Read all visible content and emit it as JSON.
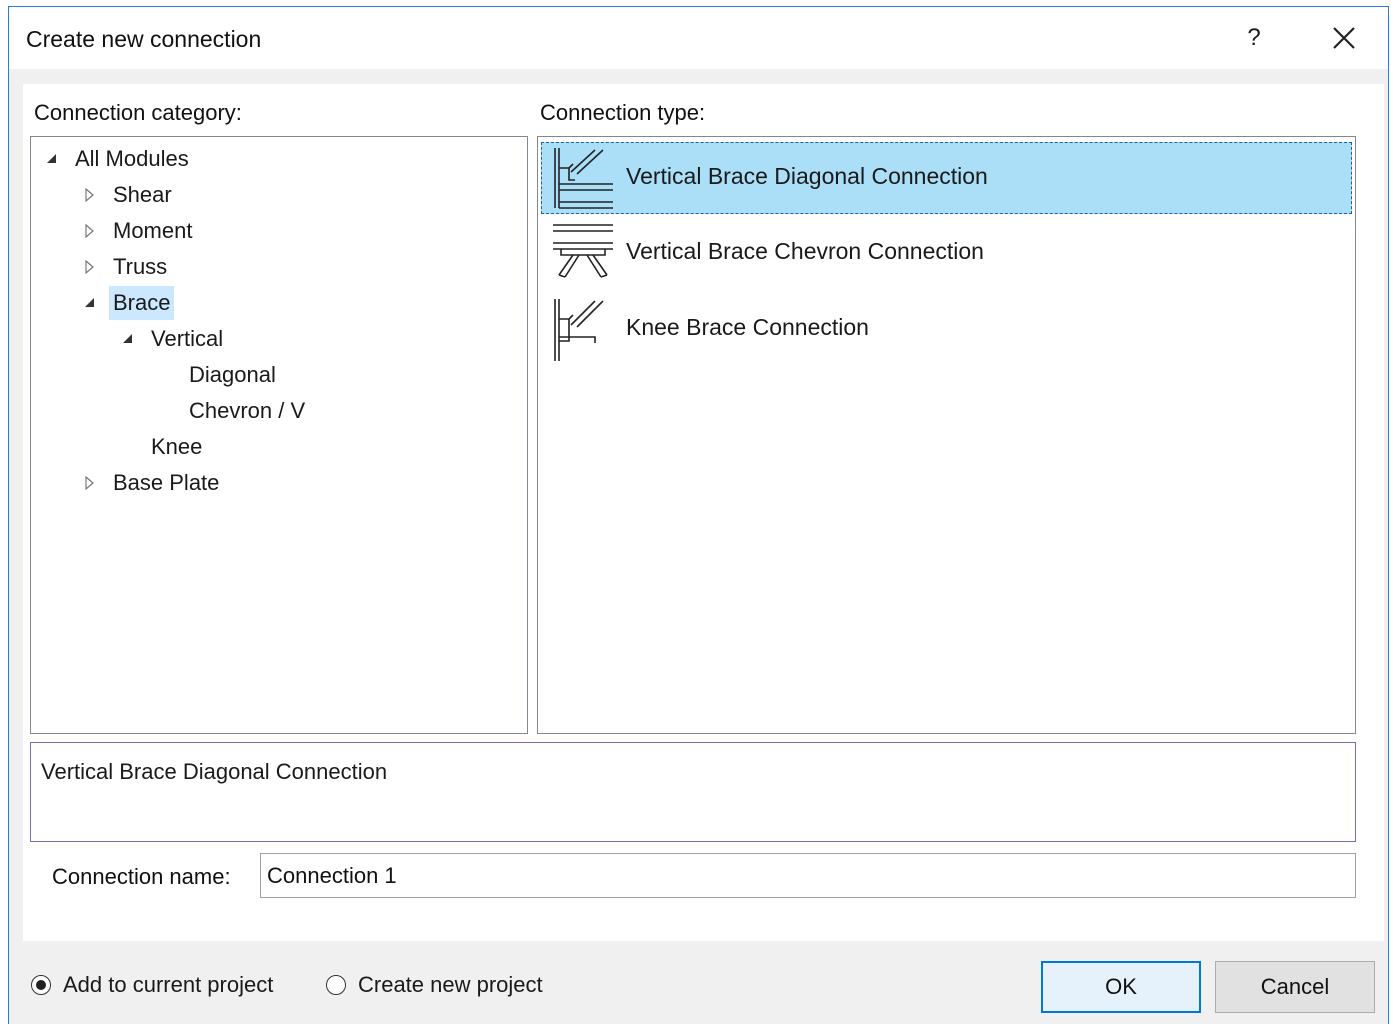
{
  "dialog": {
    "title": "Create new connection",
    "help_label": "?"
  },
  "category": {
    "label": "Connection category:",
    "tree": [
      {
        "label": "All Modules",
        "expander": "expanded"
      },
      {
        "label": "Shear",
        "expander": "collapsed"
      },
      {
        "label": "Moment",
        "expander": "collapsed"
      },
      {
        "label": "Truss",
        "expander": "collapsed"
      },
      {
        "label": "Brace",
        "expander": "expanded",
        "selected": true
      },
      {
        "label": "Vertical",
        "expander": "expanded"
      },
      {
        "label": "Diagonal",
        "expander": "none"
      },
      {
        "label": "Chevron / V",
        "expander": "none"
      },
      {
        "label": "Knee",
        "expander": "none"
      },
      {
        "label": "Base Plate",
        "expander": "collapsed"
      }
    ]
  },
  "type": {
    "label": "Connection type:",
    "items": [
      {
        "label": "Vertical Brace Diagonal Connection",
        "icon": "diagonal-brace-icon",
        "selected": true
      },
      {
        "label": "Vertical Brace Chevron Connection",
        "icon": "chevron-brace-icon",
        "selected": false
      },
      {
        "label": "Knee Brace Connection",
        "icon": "knee-brace-icon",
        "selected": false
      }
    ]
  },
  "description": "Vertical Brace Diagonal Connection",
  "name": {
    "label": "Connection name:",
    "value": "Connection 1"
  },
  "target": {
    "options": [
      {
        "label": "Add to current project",
        "checked": true
      },
      {
        "label": "Create new project",
        "checked": false
      }
    ]
  },
  "buttons": {
    "ok": "OK",
    "cancel": "Cancel"
  },
  "colors": {
    "selection": "#aadff7",
    "tree_selection": "#cce8ff",
    "accent": "#0078d7"
  }
}
